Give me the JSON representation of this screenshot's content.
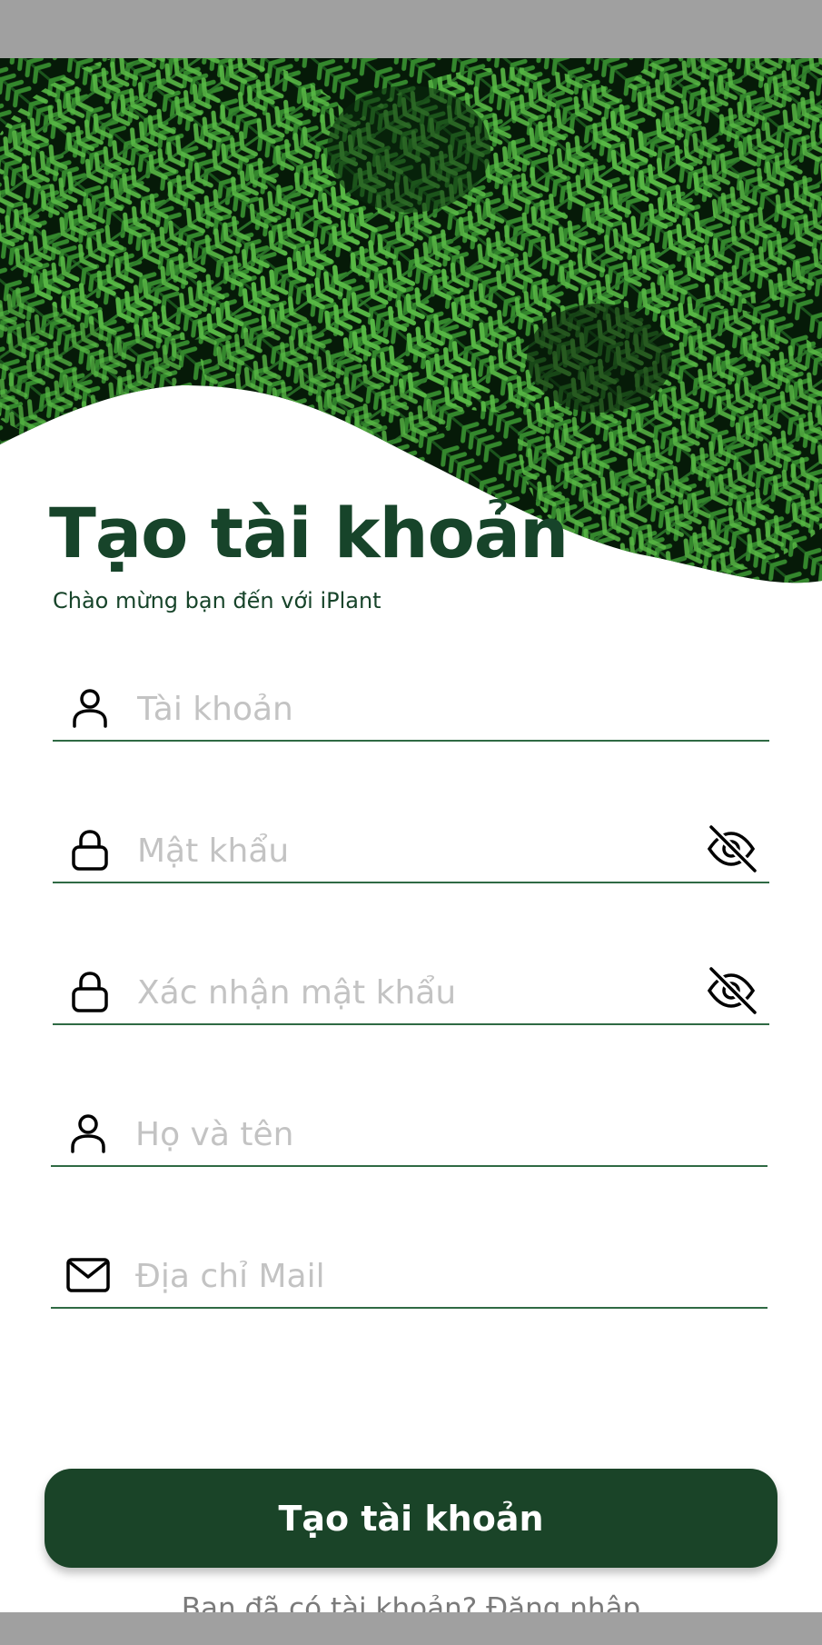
{
  "colors": {
    "brand_dark_green": "#1a4428",
    "title_green": "#17442a",
    "placeholder_gray": "#c3c3c3",
    "footer_gray": "#7a7a7a"
  },
  "header": {
    "title": "Tạo tài khoản",
    "subtitle": "Chào mừng bạn đến với iPlant",
    "background_image": "fern-leaves-photo"
  },
  "form": {
    "username": {
      "placeholder": "Tài khoản",
      "value": "",
      "icon": "user-icon"
    },
    "password": {
      "placeholder": "Mật khẩu",
      "value": "",
      "icon": "lock-icon",
      "toggle_icon": "eye-off-icon"
    },
    "confirm_password": {
      "placeholder": "Xác nhận mật khẩu",
      "value": "",
      "icon": "lock-icon",
      "toggle_icon": "eye-off-icon"
    },
    "full_name": {
      "placeholder": "Họ và tên",
      "value": "",
      "icon": "user-icon"
    },
    "email": {
      "placeholder": "Địa chỉ Mail",
      "value": "",
      "icon": "mail-icon"
    }
  },
  "actions": {
    "submit_label": "Tạo tài khoản"
  },
  "footer": {
    "prompt": "Bạn đã có tài khoản?",
    "login_link": "Đăng nhập"
  }
}
